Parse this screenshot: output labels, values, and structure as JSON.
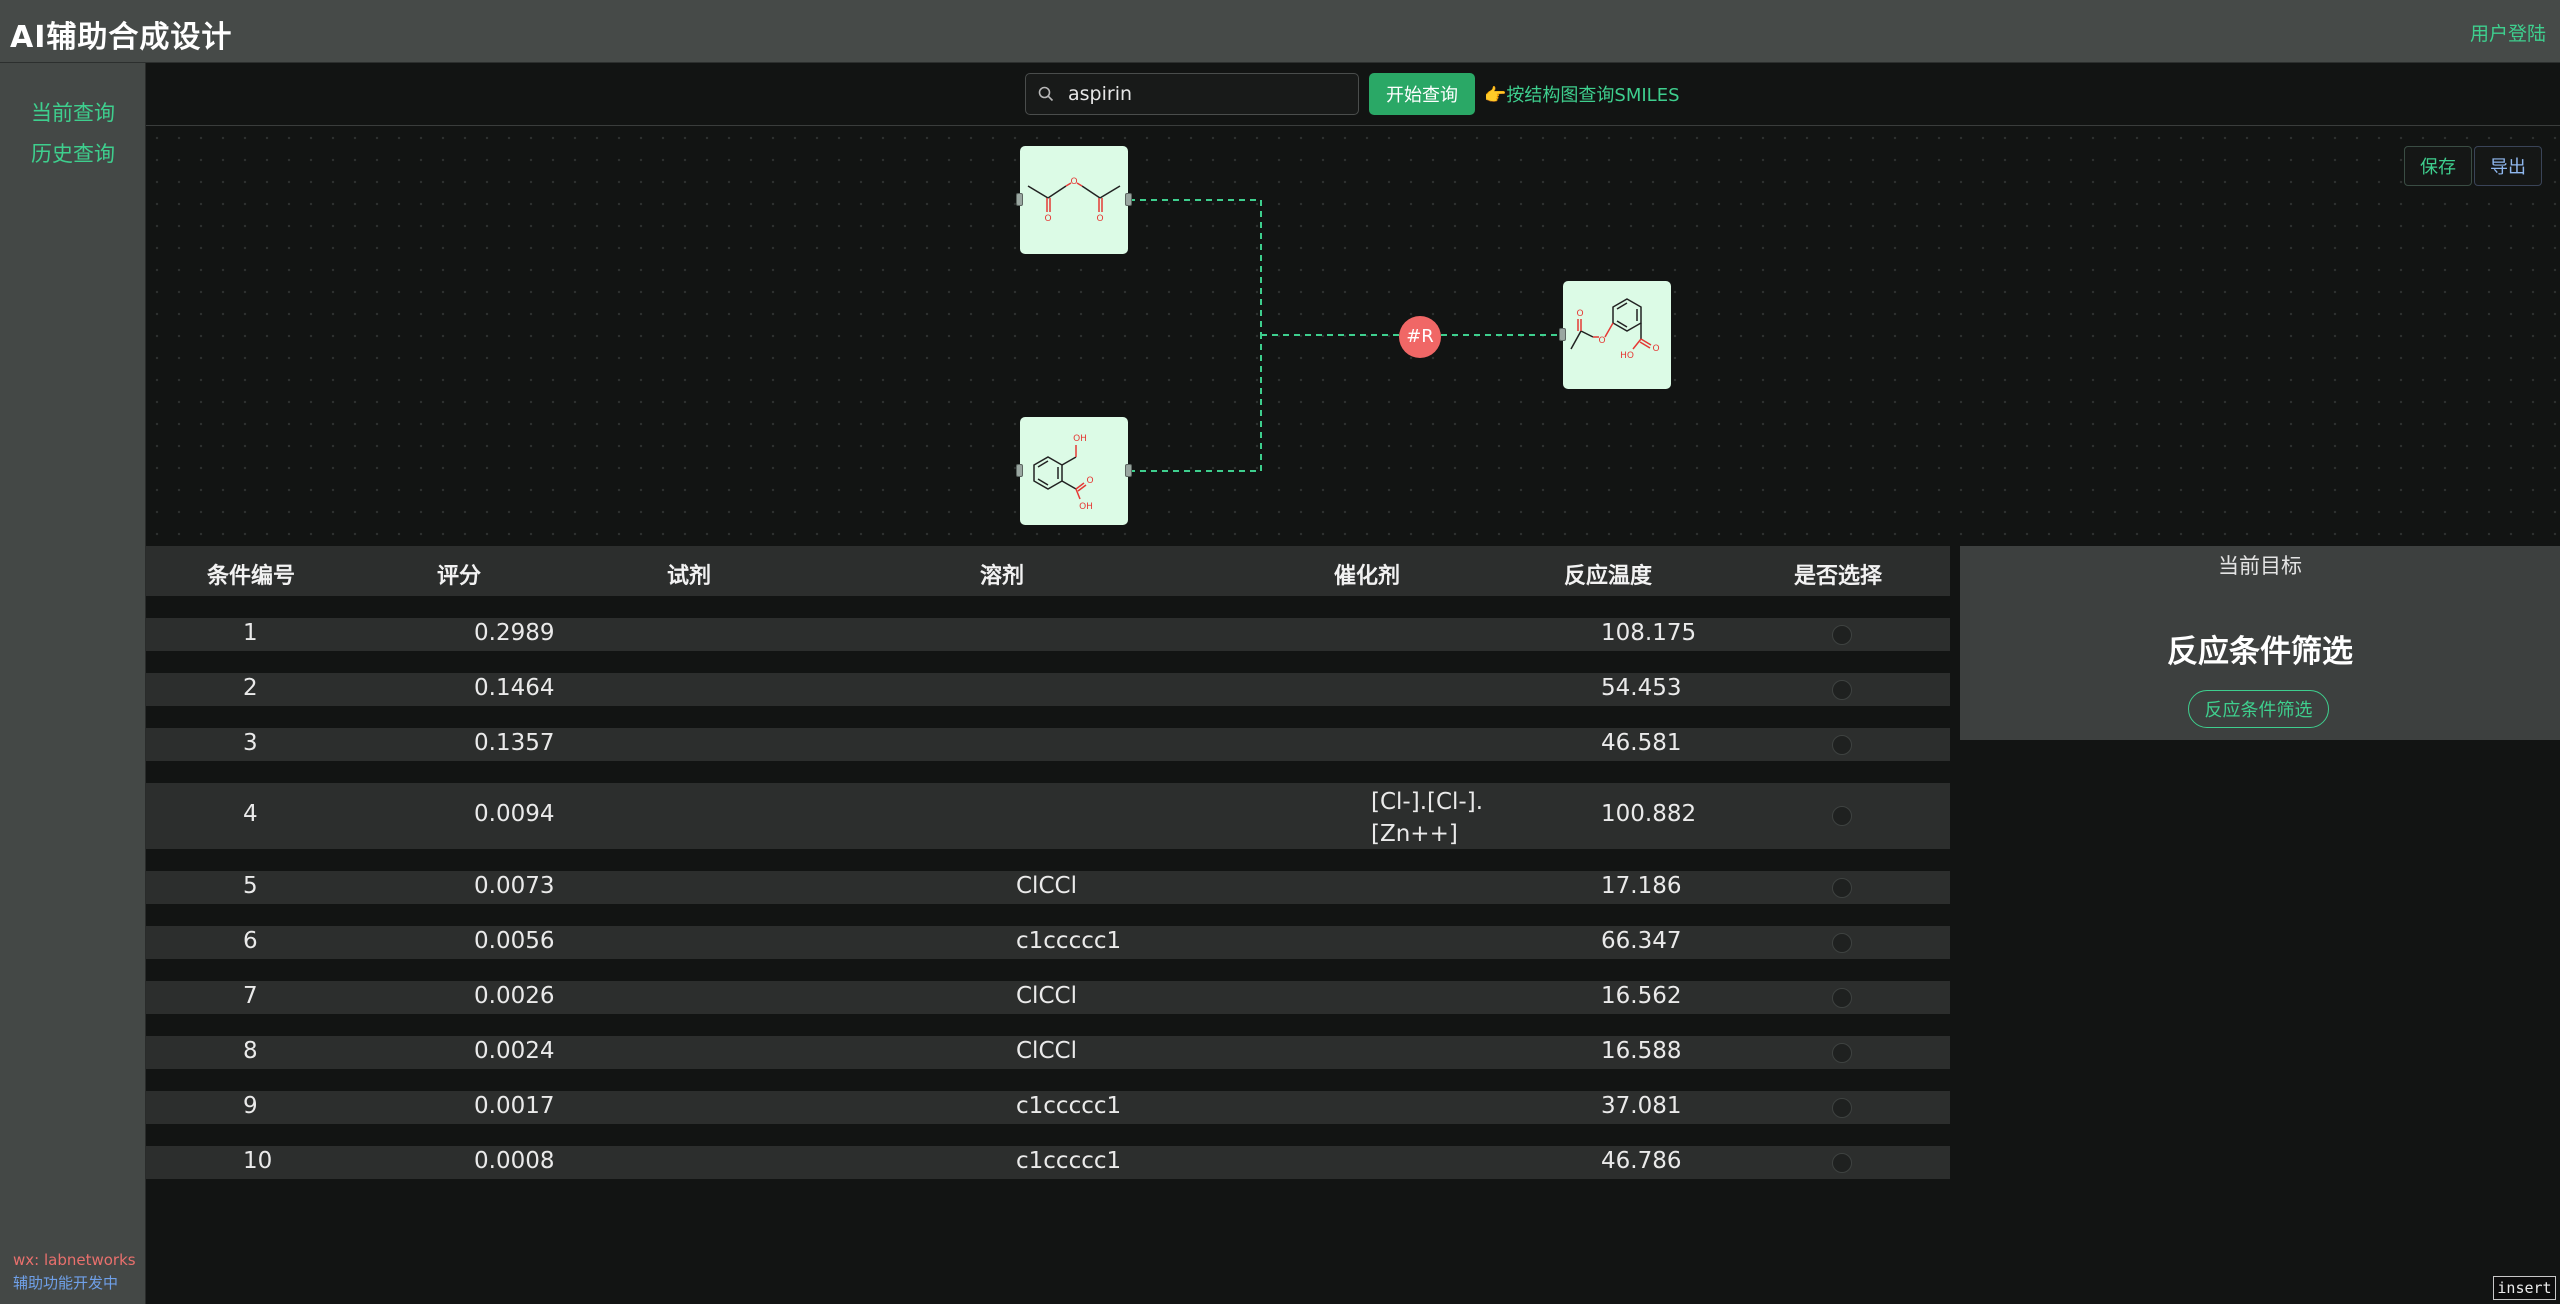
{
  "header": {
    "title": "AI辅助合成设计",
    "login_label": "用户登陆"
  },
  "sidebar": {
    "items": [
      {
        "label": "当前查询"
      },
      {
        "label": "历史查询"
      }
    ],
    "footer_contact": "wx: labnetworks",
    "footer_note": "辅助功能开发中"
  },
  "search": {
    "value": "aspirin",
    "button_label": "开始查询",
    "structure_link": "👉按结构图查询SMILES"
  },
  "canvas": {
    "save_label": "保存",
    "export_label": "导出",
    "reaction_node_label": "#R",
    "molecules": [
      "acetic-anhydride",
      "salicylic-acid",
      "aspirin"
    ],
    "colors": {
      "node_bg": "#dcfbe6",
      "reaction_node": "#f06766",
      "edge": "#3ecf8e"
    }
  },
  "table": {
    "headers": [
      "条件编号",
      "评分",
      "试剂",
      "溶剂",
      "催化剂",
      "反应温度",
      "是否选择"
    ],
    "rows": [
      {
        "id": "1",
        "score": "0.2989",
        "reagent": "",
        "solvent": "",
        "catalyst": "",
        "temperature": "108.175"
      },
      {
        "id": "2",
        "score": "0.1464",
        "reagent": "",
        "solvent": "",
        "catalyst": "",
        "temperature": "54.453"
      },
      {
        "id": "3",
        "score": "0.1357",
        "reagent": "",
        "solvent": "",
        "catalyst": "",
        "temperature": "46.581"
      },
      {
        "id": "4",
        "score": "0.0094",
        "reagent": "",
        "solvent": "",
        "catalyst": "[Cl-].[Cl-].[Zn++]",
        "temperature": "100.882"
      },
      {
        "id": "5",
        "score": "0.0073",
        "reagent": "",
        "solvent": "ClCCl",
        "catalyst": "",
        "temperature": "17.186"
      },
      {
        "id": "6",
        "score": "0.0056",
        "reagent": "",
        "solvent": "c1ccccc1",
        "catalyst": "",
        "temperature": "66.347"
      },
      {
        "id": "7",
        "score": "0.0026",
        "reagent": "",
        "solvent": "ClCCl",
        "catalyst": "",
        "temperature": "16.562"
      },
      {
        "id": "8",
        "score": "0.0024",
        "reagent": "",
        "solvent": "ClCCl",
        "catalyst": "",
        "temperature": "16.588"
      },
      {
        "id": "9",
        "score": "0.0017",
        "reagent": "",
        "solvent": "c1ccccc1",
        "catalyst": "",
        "temperature": "37.081"
      },
      {
        "id": "10",
        "score": "0.0008",
        "reagent": "",
        "solvent": "c1ccccc1",
        "catalyst": "",
        "temperature": "46.786"
      }
    ]
  },
  "panel": {
    "title": "当前目标",
    "heading": "反应条件筛选",
    "button_label": "反应条件筛选"
  },
  "status": {
    "mode": "insert"
  }
}
